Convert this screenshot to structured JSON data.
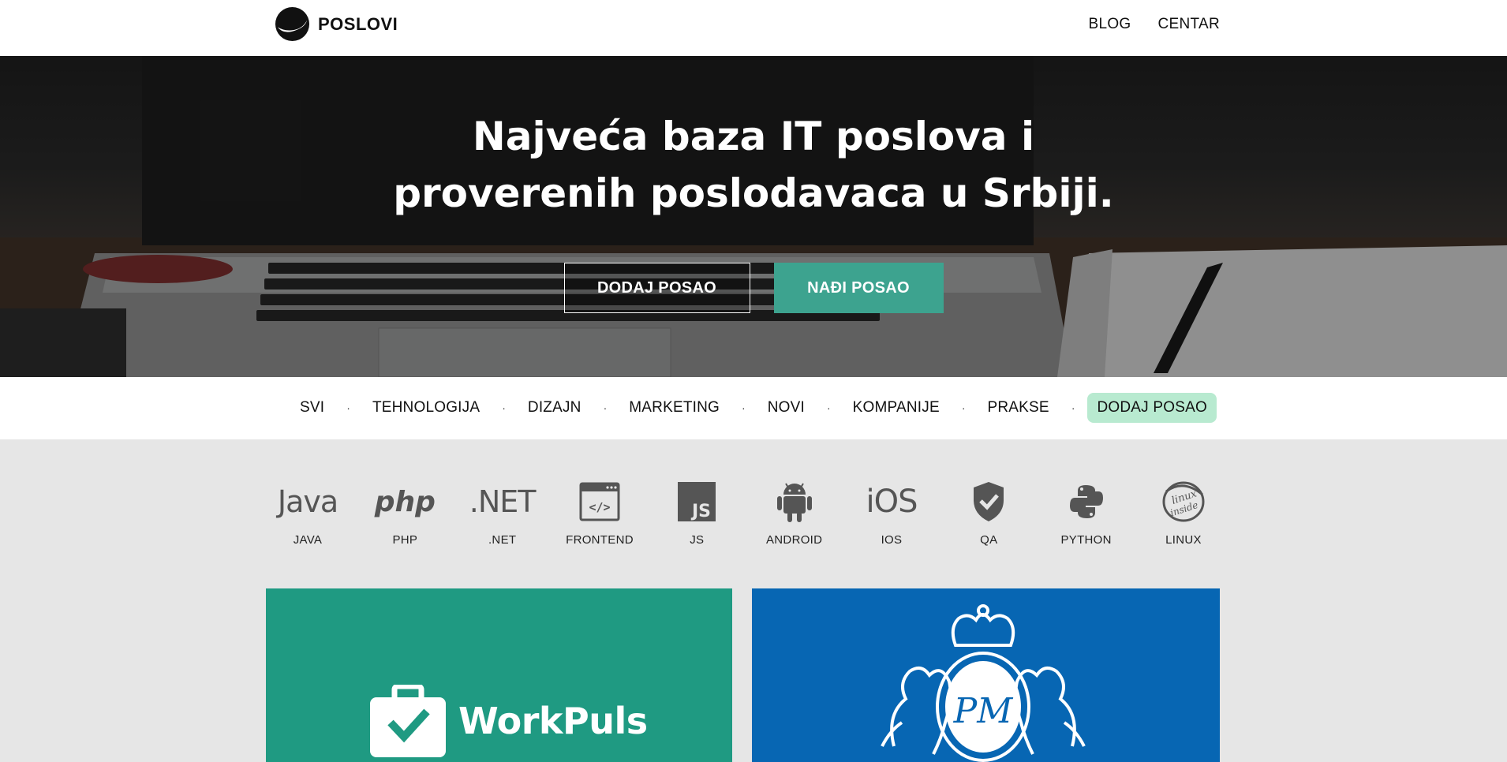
{
  "header": {
    "logo_text": "POSLOVI",
    "nav": [
      "BLOG",
      "CENTAR"
    ]
  },
  "hero": {
    "title_line1": "Najveća baza IT poslova i",
    "title_line2": "proverenih poslodavaca u Srbiji.",
    "btn_add": "DODAJ POSAO",
    "btn_find": "NAĐI POSAO"
  },
  "categories": {
    "items": [
      "SVI",
      "TEHNOLOGIJA",
      "DIZAJN",
      "MARKETING",
      "NOVI",
      "KOMPANIJE",
      "PRAKSE",
      "DODAJ POSAO"
    ],
    "separator": "·"
  },
  "tech": {
    "java": {
      "icon_text": "Java",
      "label": "JAVA"
    },
    "php": {
      "icon_text": "php",
      "label": "PHP"
    },
    "net": {
      "icon_text": ".NET",
      "label": ".NET"
    },
    "frontend": {
      "icon_text": "</>",
      "label": "FRONTEND"
    },
    "js": {
      "icon_text": "JS",
      "label": "JS"
    },
    "android": {
      "label": "ANDROID"
    },
    "ios": {
      "icon_text": "iOS",
      "label": "IOS"
    },
    "qa": {
      "label": "QA"
    },
    "python": {
      "label": "PYTHON"
    },
    "linux": {
      "icon_text_1": "linux",
      "icon_text_2": "inside",
      "label": "LINUX"
    }
  },
  "cards": {
    "workpuls": {
      "name": "WorkPuls",
      "bg": "#1f9a82"
    },
    "pm": {
      "monogram": "PM",
      "bg": "#0766b3"
    }
  },
  "colors": {
    "accent": "#3da38f",
    "highlight": "#b8ead0"
  }
}
